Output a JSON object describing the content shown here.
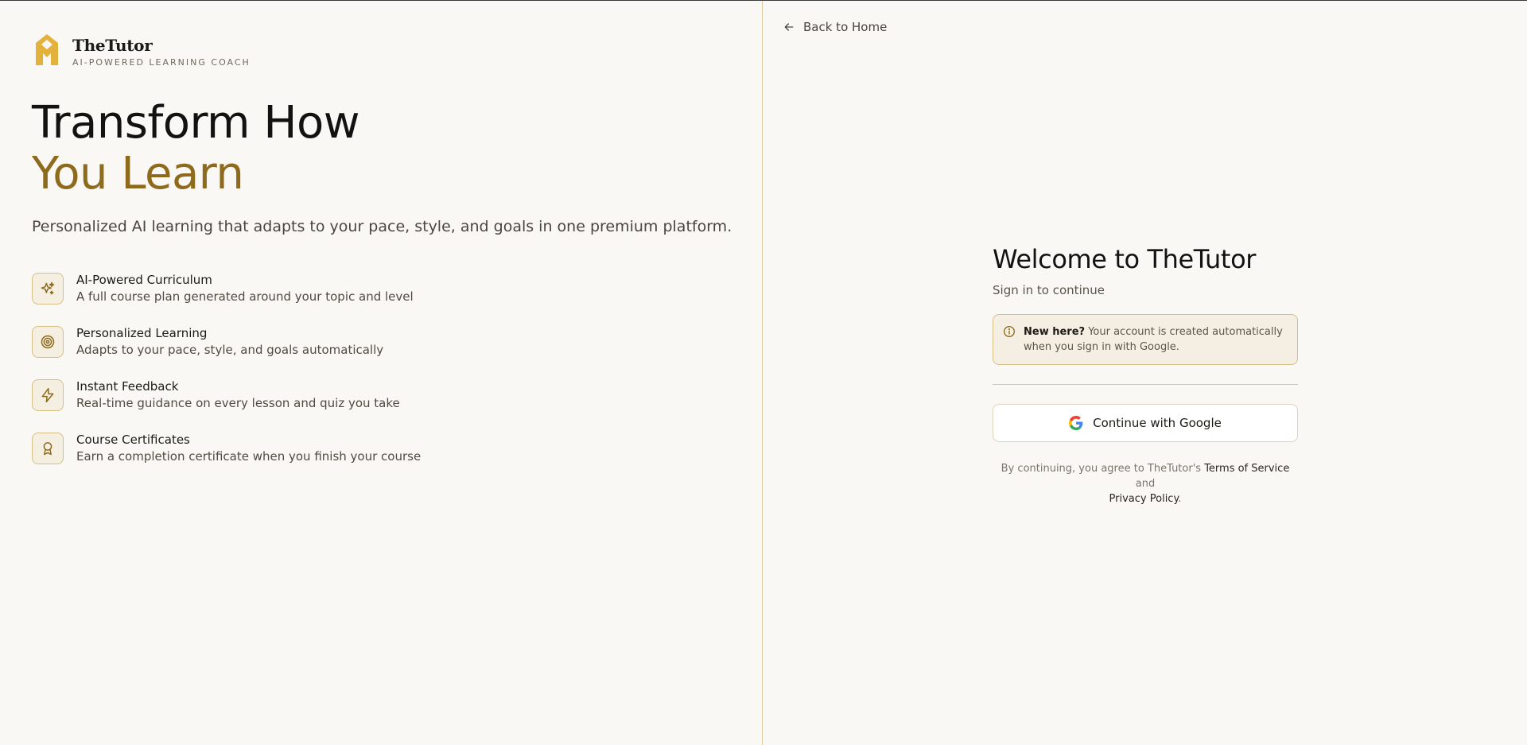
{
  "brand": {
    "name": "TheTutor",
    "tagline": "AI-POWERED LEARNING COACH",
    "accent_color": "#8d6a1c",
    "logo_color": "#e3b23c"
  },
  "hero": {
    "line1": "Transform How",
    "line2": "You Learn",
    "subtitle": "Personalized AI learning that adapts to your pace, style, and goals in one premium platform."
  },
  "features": [
    {
      "icon": "sparkles-icon",
      "title": "AI-Powered Curriculum",
      "description": "A full course plan generated around your topic and level"
    },
    {
      "icon": "target-icon",
      "title": "Personalized Learning",
      "description": "Adapts to your pace, style, and goals automatically"
    },
    {
      "icon": "lightning-icon",
      "title": "Instant Feedback",
      "description": "Real-time guidance on every lesson and quiz you take"
    },
    {
      "icon": "award-icon",
      "title": "Course Certificates",
      "description": "Earn a completion certificate when you finish your course"
    }
  ],
  "nav": {
    "back_label": "Back to Home",
    "back_icon": "arrow-left-icon"
  },
  "auth": {
    "title": "Welcome to TheTutor",
    "subtitle": "Sign in to continue",
    "notice": {
      "icon": "info-icon",
      "strong": "New here?",
      "text": " Your account is created automatically when you sign in with Google."
    },
    "google_button_label": "Continue with Google",
    "legal": {
      "prefix": "By continuing, you agree to TheTutor's ",
      "terms_label": "Terms of Service",
      "middle": " and",
      "privacy_label": "Privacy Policy",
      "suffix": "."
    }
  }
}
